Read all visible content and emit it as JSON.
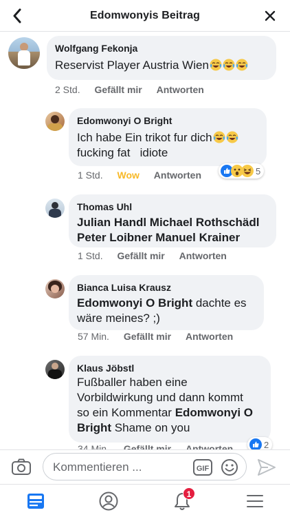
{
  "header": {
    "title": "Edomwonyis Beitrag",
    "back_icon": "chevron-left-icon",
    "close_icon": "close-icon"
  },
  "comments": [
    {
      "author": "Wolfgang Fekonja",
      "text": "Reservist Player Austria Wien",
      "emojis": [
        "tears-of-joy",
        "tears-of-joy",
        "tears-of-joy"
      ],
      "time": "2 Std.",
      "like": "Gefällt mir",
      "reply": "Antworten"
    },
    {
      "author": "Edomwonyi O Bright",
      "text_line1": "Ich habe Ein trikot fur dich",
      "text_line2": "fucking fat   idiote",
      "emojis": [
        "tears-of-joy",
        "tears-of-joy"
      ],
      "time": "1 Std.",
      "like": "Wow",
      "reply": "Antworten",
      "reactions": {
        "types": [
          "like",
          "wow",
          "haha"
        ],
        "count": "5"
      }
    },
    {
      "author": "Thomas Uhl",
      "text_line1": "Julian Handl Michael Rothschädl",
      "text_line2": "Peter Loibner Manuel Krainer",
      "time": "1 Std.",
      "like": "Gefällt mir",
      "reply": "Antworten"
    },
    {
      "author": "Bianca Luisa Krausz",
      "mention": "Edomwonyi O Bright",
      "text_after": " dachte es",
      "text_line2": "wäre meines? ;)",
      "time": "57 Min.",
      "like": "Gefällt mir",
      "reply": "Antworten"
    },
    {
      "author": "Klaus Jöbstl",
      "text_line1": "Fußballer haben eine",
      "text_line2": "Vorbildwirkung und dann kommt",
      "text_line3_pre": "so ein Kommentar ",
      "text_line3_mention": "Edomwonyi O",
      "text_line4_mention": "Bright",
      "text_line4_post": " Shame on you",
      "time": "34 Min.",
      "like": "Gefällt mir",
      "reply": "Antworten",
      "reactions": {
        "types": [
          "like"
        ],
        "count": "2"
      }
    }
  ],
  "composer": {
    "placeholder": "Kommentieren ...",
    "gif_label": "GIF",
    "camera_icon": "camera-icon",
    "smile_icon": "smile-icon",
    "send_icon": "send-icon"
  },
  "nav": {
    "items": [
      "feed-icon",
      "profile-icon",
      "notifications-icon",
      "menu-icon"
    ],
    "notification_badge": "1"
  },
  "colors": {
    "accent": "#1877f2",
    "bubble": "#f0f2f5",
    "wow": "#f7b928",
    "badge": "#e41e3f"
  }
}
